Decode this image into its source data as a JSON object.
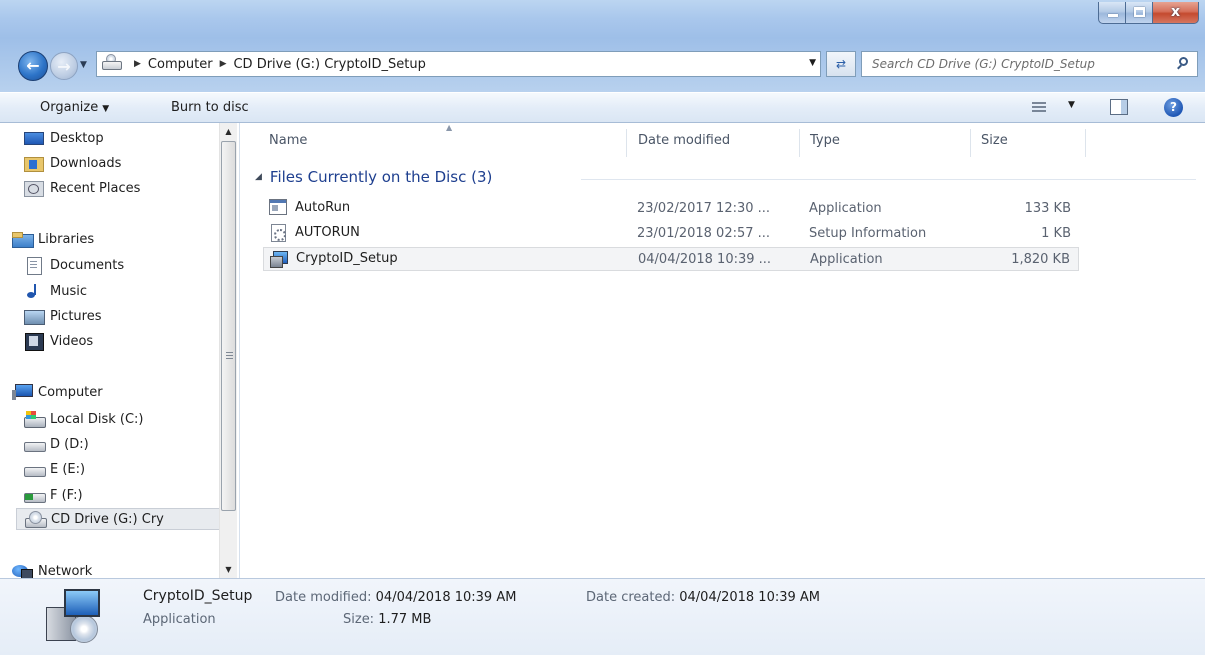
{
  "window": {
    "controls": {
      "minimize": "minimize",
      "maximize": "maximize",
      "close": "x"
    }
  },
  "address_bar": {
    "breadcrumbs": [
      "Computer",
      "CD Drive (G:) CryptoID_Setup"
    ],
    "search_placeholder": "Search CD Drive (G:) CryptoID_Setup"
  },
  "toolbar": {
    "organize_label": "Organize",
    "burn_label": "Burn to disc",
    "help_label": "?"
  },
  "sidebar": {
    "favorites": [
      {
        "label": "Desktop",
        "icon": "desktop-icon"
      },
      {
        "label": "Downloads",
        "icon": "downloads-icon"
      },
      {
        "label": "Recent Places",
        "icon": "recent-places-icon"
      }
    ],
    "libraries": {
      "label": "Libraries",
      "items": [
        {
          "label": "Documents",
          "icon": "documents-icon"
        },
        {
          "label": "Music",
          "icon": "music-icon"
        },
        {
          "label": "Pictures",
          "icon": "pictures-icon"
        },
        {
          "label": "Videos",
          "icon": "videos-icon"
        }
      ]
    },
    "computer": {
      "label": "Computer",
      "items": [
        {
          "label": "Local Disk (C:)",
          "icon": "local-disk-icon"
        },
        {
          "label": "D (D:)",
          "icon": "drive-icon"
        },
        {
          "label": "E (E:)",
          "icon": "drive-icon"
        },
        {
          "label": "F (F:)",
          "icon": "network-drive-icon"
        },
        {
          "label": "CD Drive (G:) Cry",
          "icon": "cd-drive-icon",
          "selected": true
        }
      ]
    },
    "network": {
      "label": "Network"
    }
  },
  "content": {
    "columns": [
      "Name",
      "Date modified",
      "Type",
      "Size"
    ],
    "group_label": "Files Currently on the Disc (3)",
    "files": [
      {
        "name": "AutoRun",
        "date": "23/02/2017 12:30 ...",
        "type": "Application",
        "size": "133 KB",
        "icon": "application-icon"
      },
      {
        "name": "AUTORUN",
        "date": "23/01/2018 02:57 ...",
        "type": "Setup Information",
        "size": "1 KB",
        "icon": "setup-information-icon"
      },
      {
        "name": "CryptoID_Setup",
        "date": "04/04/2018 10:39 ...",
        "type": "Application",
        "size": "1,820 KB",
        "icon": "installer-icon",
        "selected": true
      }
    ]
  },
  "details": {
    "name": "CryptoID_Setup",
    "kind": "Application",
    "date_modified_label": "Date modified:",
    "date_modified": "04/04/2018 10:39 AM",
    "size_label": "Size:",
    "size": "1.77 MB",
    "date_created_label": "Date created:",
    "date_created": "04/04/2018 10:39 AM"
  }
}
